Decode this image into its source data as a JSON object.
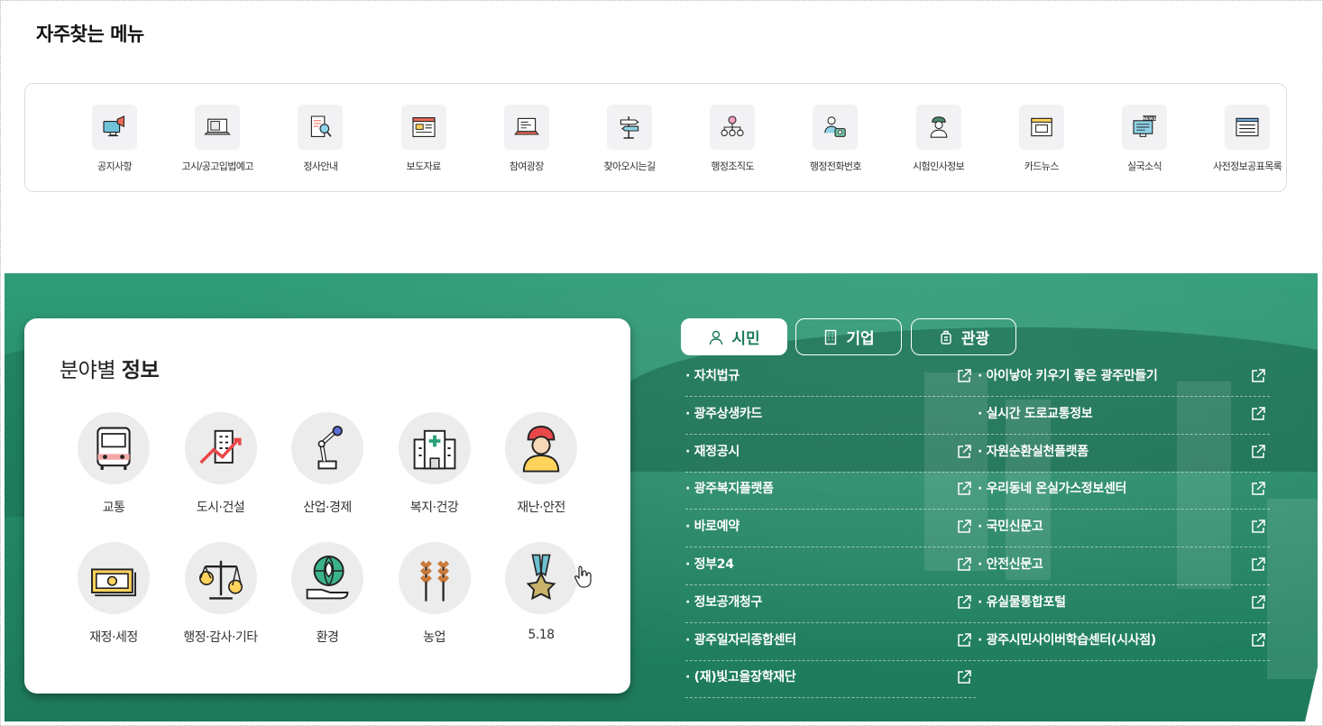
{
  "frequent_menu": {
    "title": "자주찾는 메뉴",
    "items": [
      {
        "label": "공지사항",
        "icon": "megaphone-monitor-icon"
      },
      {
        "label": "고시/공고입법예고",
        "icon": "laptop-document-icon"
      },
      {
        "label": "정사안내",
        "icon": "document-magnifier-icon"
      },
      {
        "label": "보도자료",
        "icon": "browser-window-icon"
      },
      {
        "label": "참여광장",
        "icon": "laptop-chat-icon"
      },
      {
        "label": "찾아오시는길",
        "icon": "signpost-icon"
      },
      {
        "label": "행정조직도",
        "icon": "org-chart-icon"
      },
      {
        "label": "행정전화번호",
        "icon": "person-telephone-icon"
      },
      {
        "label": "시험인사정보",
        "icon": "officer-icon"
      },
      {
        "label": "카드뉴스",
        "icon": "card-news-icon"
      },
      {
        "label": "실국소식",
        "icon": "news-monitor-icon"
      },
      {
        "label": "사전정보공표목록",
        "icon": "list-window-icon"
      }
    ]
  },
  "field_info": {
    "title_normal": "분야별",
    "title_bold": "정보",
    "categories": [
      {
        "label": "교통",
        "icon": "bus-icon"
      },
      {
        "label": "도시·건설",
        "icon": "city-growth-icon"
      },
      {
        "label": "산업·경제",
        "icon": "robot-arm-icon"
      },
      {
        "label": "복지·건강",
        "icon": "hospital-icon"
      },
      {
        "label": "재난·안전",
        "icon": "firefighter-icon"
      },
      {
        "label": "재정·세정",
        "icon": "money-icon"
      },
      {
        "label": "행정·감사·기타",
        "icon": "scale-icon"
      },
      {
        "label": "환경",
        "icon": "globe-hand-icon"
      },
      {
        "label": "농업",
        "icon": "wheat-icon"
      },
      {
        "label": "5.18",
        "icon": "medal-icon"
      }
    ]
  },
  "tabs": [
    {
      "label": "시민",
      "icon": "person-icon",
      "active": true
    },
    {
      "label": "기업",
      "icon": "building-icon",
      "active": false
    },
    {
      "label": "관광",
      "icon": "luggage-icon",
      "active": false
    }
  ],
  "links_left": [
    {
      "label": "· 자치법규",
      "external": true
    },
    {
      "label": "· 광주상생카드",
      "external": false
    },
    {
      "label": "· 재정공시",
      "external": true
    },
    {
      "label": "· 광주복지플랫폼",
      "external": true
    },
    {
      "label": "· 바로예약",
      "external": true
    },
    {
      "label": "· 정부24",
      "external": true
    },
    {
      "label": "· 정보공개청구",
      "external": true
    },
    {
      "label": "· 광주일자리종합센터",
      "external": true
    },
    {
      "label": "· (재)빛고을장학재단",
      "external": true
    }
  ],
  "links_right": [
    {
      "label": "· 아이낳아 키우기 좋은 광주만들기",
      "external": true
    },
    {
      "label": "· 실시간 도로교통정보",
      "external": true
    },
    {
      "label": "· 자원순환실천플랫폼",
      "external": true
    },
    {
      "label": "· 우리동네 온실가스정보센터",
      "external": true
    },
    {
      "label": "· 국민신문고",
      "external": true
    },
    {
      "label": "· 안전신문고",
      "external": true
    },
    {
      "label": "· 유실물통합포털",
      "external": true
    },
    {
      "label": "· 광주시민사이버학습센터(시사점)",
      "external": true
    }
  ],
  "colors": {
    "accent_green": "#1a7a5c",
    "band_green": "#258a68"
  }
}
